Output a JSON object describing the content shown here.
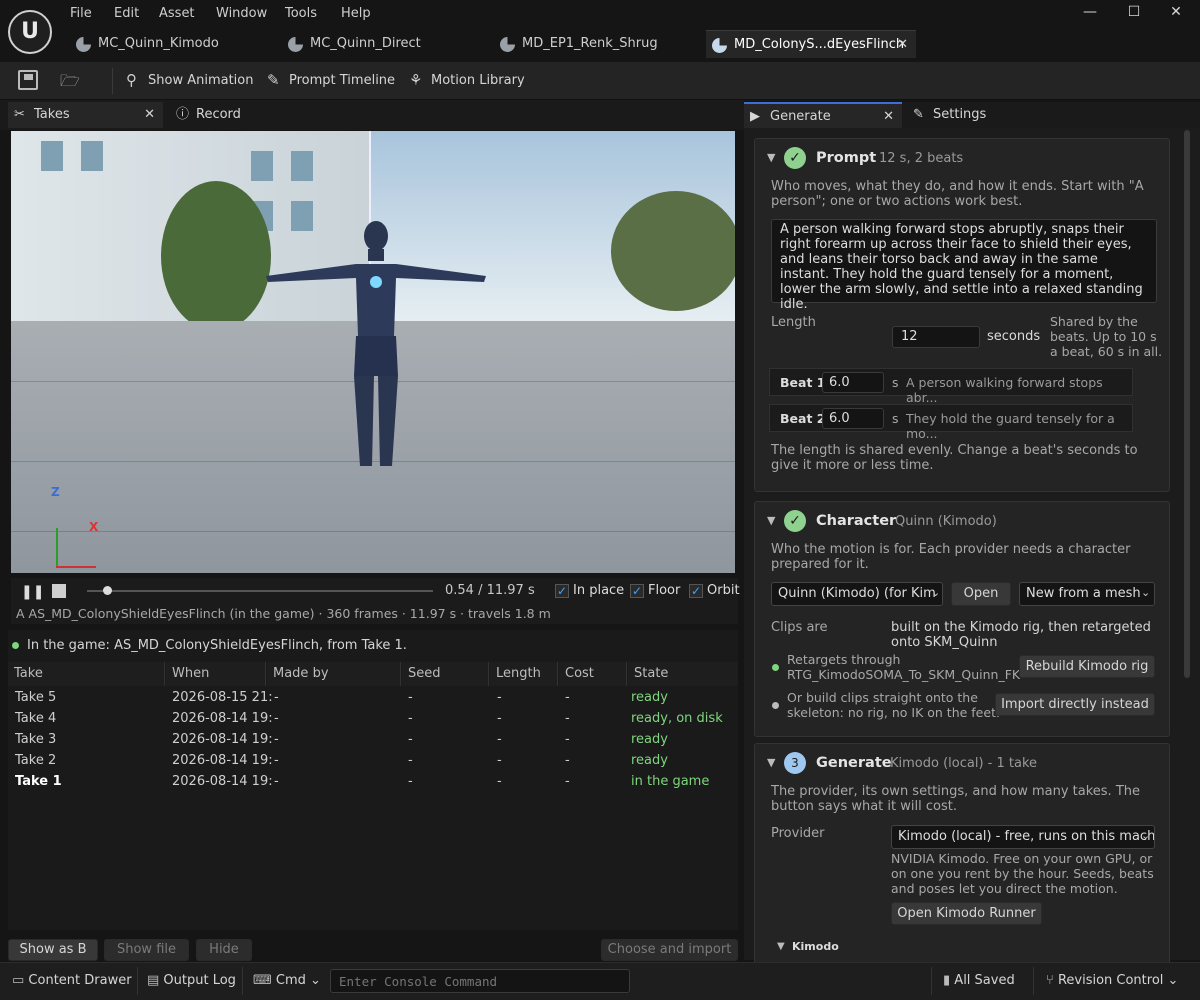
{
  "menu": [
    "File",
    "Edit",
    "Asset",
    "Window",
    "Tools",
    "Help"
  ],
  "logo_text": "U",
  "doc_tabs": [
    "MC_Quinn_Kimodo",
    "MC_Quinn_Direct",
    "MD_EP1_Renk_Shrug",
    "MD_ColonyS...dEyesFlinch"
  ],
  "window_controls": {
    "minimize": "—",
    "maximize": "☐",
    "close": "✕"
  },
  "toolbar": {
    "show_animation": "Show Animation",
    "prompt_timeline": "Prompt Timeline",
    "motion_library": "Motion Library"
  },
  "left_tabs": {
    "takes": "Takes",
    "record": "Record"
  },
  "right_tabs": {
    "generate": "Generate",
    "settings": "Settings"
  },
  "viewport": {
    "axis_z": "Z",
    "axis_x": "X"
  },
  "player": {
    "time": "0.54 / 11.97 s",
    "progress": 0.045,
    "in_place": "In place",
    "floor": "Floor",
    "orbit": "Orbit",
    "info": "A  AS_MD_ColonyShieldEyesFlinch (in the game) · 360 frames · 11.97 s · travels 1.8 m"
  },
  "takes": {
    "status": "In the game: AS_MD_ColonyShieldEyesFlinch, from Take 1.",
    "headers": [
      "Take",
      "When",
      "Made by",
      "Seed",
      "Length",
      "Cost",
      "State"
    ],
    "rows": [
      [
        "Take 5",
        "2026-08-15 21:",
        "-",
        "-",
        "-",
        "-",
        "ready"
      ],
      [
        "Take 4",
        "2026-08-14 19:",
        "-",
        "-",
        "-",
        "-",
        "ready, on disk"
      ],
      [
        "Take 3",
        "2026-08-14 19:",
        "-",
        "-",
        "-",
        "-",
        "ready"
      ],
      [
        "Take 2",
        "2026-08-14 19:",
        "-",
        "-",
        "-",
        "-",
        "ready"
      ],
      [
        "Take 1",
        "2026-08-14 19:",
        "-",
        "-",
        "-",
        "-",
        "in the game"
      ]
    ],
    "show_as": "Show as B",
    "show_file": "Show file",
    "hide": "Hide",
    "choose_import": "Choose and import"
  },
  "prompt": {
    "title": "Prompt",
    "meta": "12 s, 2 beats",
    "hint": "Who moves, what they do, and how it ends. Start with \"A person\"; one or two actions work best.",
    "text": "A person walking forward stops abruptly, snaps their right forearm up across their face to shield their eyes, and leans their torso back and away in the same instant. They hold the guard tensely for a moment, lower the arm slowly, and settle into a relaxed standing idle.",
    "length_label": "Length",
    "length_value": "12",
    "seconds": "seconds",
    "shared_note": "Shared by the beats. Up to 10 s a beat, 60 s in all.",
    "beat1_label": "Beat 1",
    "beat1_value": "6.0",
    "beat1_unit": "s",
    "beat1_text": "A person walking forward stops abr...",
    "beat2_label": "Beat 2",
    "beat2_value": "6.0",
    "beat2_unit": "s",
    "beat2_text": "They hold the guard tensely for a mo...",
    "footer": "The length is shared evenly. Change a beat's seconds to give it more or less time."
  },
  "character": {
    "title": "Character",
    "meta": "Quinn (Kimodo)",
    "hint": "Who the motion is for. Each provider needs a character prepared for it.",
    "select": "Quinn (Kimodo)  (for Kim",
    "open": "Open",
    "new_from": "New from a mesh",
    "clips_label": "Clips are",
    "clips_value": "built on the Kimodo rig, then retargeted onto SKM_Quinn",
    "retarget_text": "Retargets through RTG_KimodoSOMA_To_SKM_Quinn_FK",
    "rebuild": "Rebuild Kimodo rig",
    "direct_text": "Or build clips straight onto the skeleton: no rig, no IK on the feet.",
    "import_direct": "Import directly instead"
  },
  "generate": {
    "num": "3",
    "title": "Generate",
    "meta": "Kimodo (local)  -  1 take",
    "hint": "The provider, its own settings, and how many takes. The button says what it will cost.",
    "provider_label": "Provider",
    "provider_value": "Kimodo (local)  -  free, runs on this mach",
    "provider_desc": "NVIDIA Kimodo. Free on your own GPU, or on one you rent by the hour. Seeds, beats and poses let you direct the motion.",
    "open_runner": "Open Kimodo Runner",
    "kimodo_section": "Kimodo"
  },
  "statusbar": {
    "content_drawer": "Content Drawer",
    "output_log": "Output Log",
    "cmd": "Cmd",
    "console_placeholder": "Enter Console Command",
    "all_saved": "All Saved",
    "revision": "Revision Control"
  }
}
